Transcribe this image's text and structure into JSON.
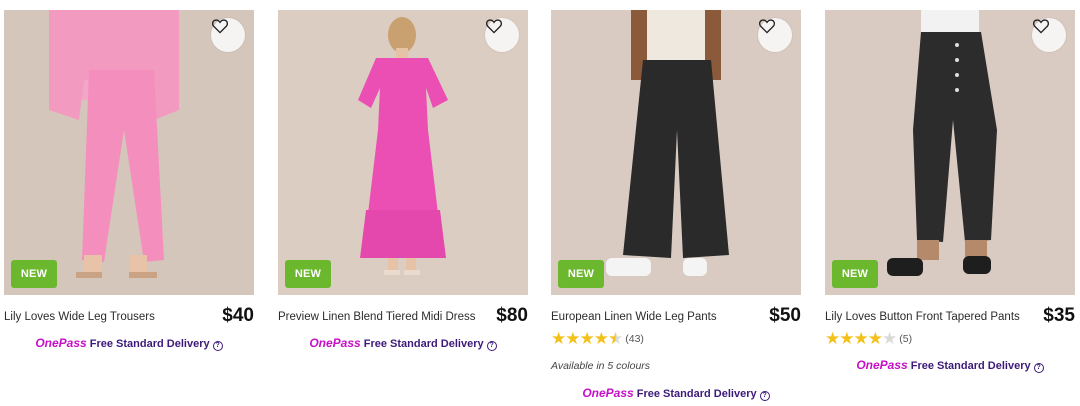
{
  "products": [
    {
      "title": "Lily Loves Wide Leg Trousers",
      "price": "$40",
      "badge": "NEW",
      "delivery": {
        "brand": "OnePass",
        "text": "Free Standard Delivery",
        "help": "?"
      }
    },
    {
      "title": "Preview Linen Blend Tiered Midi Dress",
      "price": "$80",
      "badge": "NEW",
      "delivery": {
        "brand": "OnePass",
        "text": "Free Standard Delivery",
        "help": "?"
      }
    },
    {
      "title": "European Linen Wide Leg Pants",
      "price": "$50",
      "badge": "NEW",
      "rating": 4.5,
      "reviews": "(43)",
      "availability": "Available in 5 colours",
      "delivery": {
        "brand": "OnePass",
        "text": "Free Standard Delivery",
        "help": "?"
      }
    },
    {
      "title": "Lily Loves Button Front Tapered Pants",
      "price": "$35",
      "badge": "NEW",
      "rating": 4,
      "reviews": "(5)",
      "delivery": {
        "brand": "OnePass",
        "text": "Free Standard Delivery",
        "help": "?"
      }
    }
  ],
  "colors": {
    "badge": "#6bb72e",
    "onepass": "#c60fc8",
    "delivery": "#3d1a7a",
    "star": "#f2c21b"
  },
  "icons": {
    "wishlist": "heart-outline-icon",
    "help": "question-circle-icon"
  }
}
